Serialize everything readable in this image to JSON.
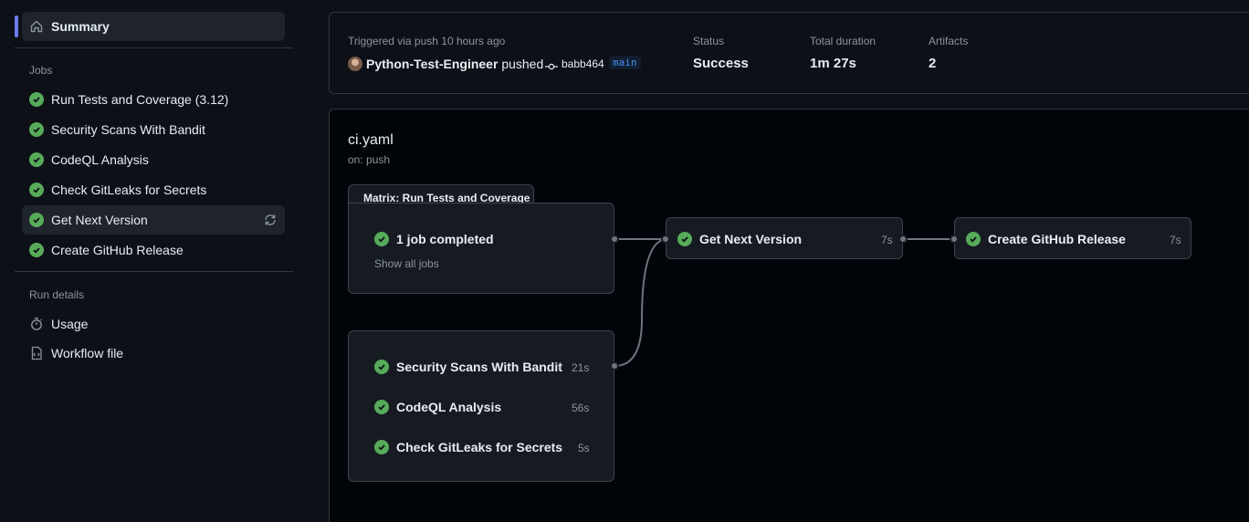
{
  "sidebar": {
    "summary": "Summary",
    "jobs_heading": "Jobs",
    "jobs": [
      {
        "label": "Run Tests and Coverage (3.12)",
        "status": "success"
      },
      {
        "label": "Security Scans With Bandit",
        "status": "success"
      },
      {
        "label": "CodeQL Analysis",
        "status": "success"
      },
      {
        "label": "Check GitLeaks for Secrets",
        "status": "success"
      },
      {
        "label": "Get Next Version",
        "status": "success"
      },
      {
        "label": "Create GitHub Release",
        "status": "success"
      }
    ],
    "run_details_heading": "Run details",
    "usage": "Usage",
    "workflow_file": "Workflow file"
  },
  "summary": {
    "triggered": "Triggered via push 10 hours ago",
    "actor": "Python-Test-Engineer",
    "action": "pushed",
    "commit": "babb464",
    "branch": "main",
    "status_label": "Status",
    "status_value": "Success",
    "duration_label": "Total duration",
    "duration_value": "1m 27s",
    "artifacts_label": "Artifacts",
    "artifacts_value": "2"
  },
  "workflow": {
    "name": "ci.yaml",
    "trigger": "on: push",
    "matrix_title": "Matrix: Run Tests and Coverage",
    "matrix_status": "1 job completed",
    "show_all": "Show all jobs",
    "group_jobs": [
      {
        "label": "Security Scans With Bandit",
        "duration": "21s"
      },
      {
        "label": "CodeQL Analysis",
        "duration": "56s"
      },
      {
        "label": "Check GitLeaks for Secrets",
        "duration": "5s"
      }
    ],
    "next_version": {
      "label": "Get Next Version",
      "duration": "7s"
    },
    "release": {
      "label": "Create GitHub Release",
      "duration": "7s"
    }
  },
  "colors": {
    "success": "#57ab5a",
    "accent": "#6e7bf2",
    "link": "#4493f8"
  }
}
